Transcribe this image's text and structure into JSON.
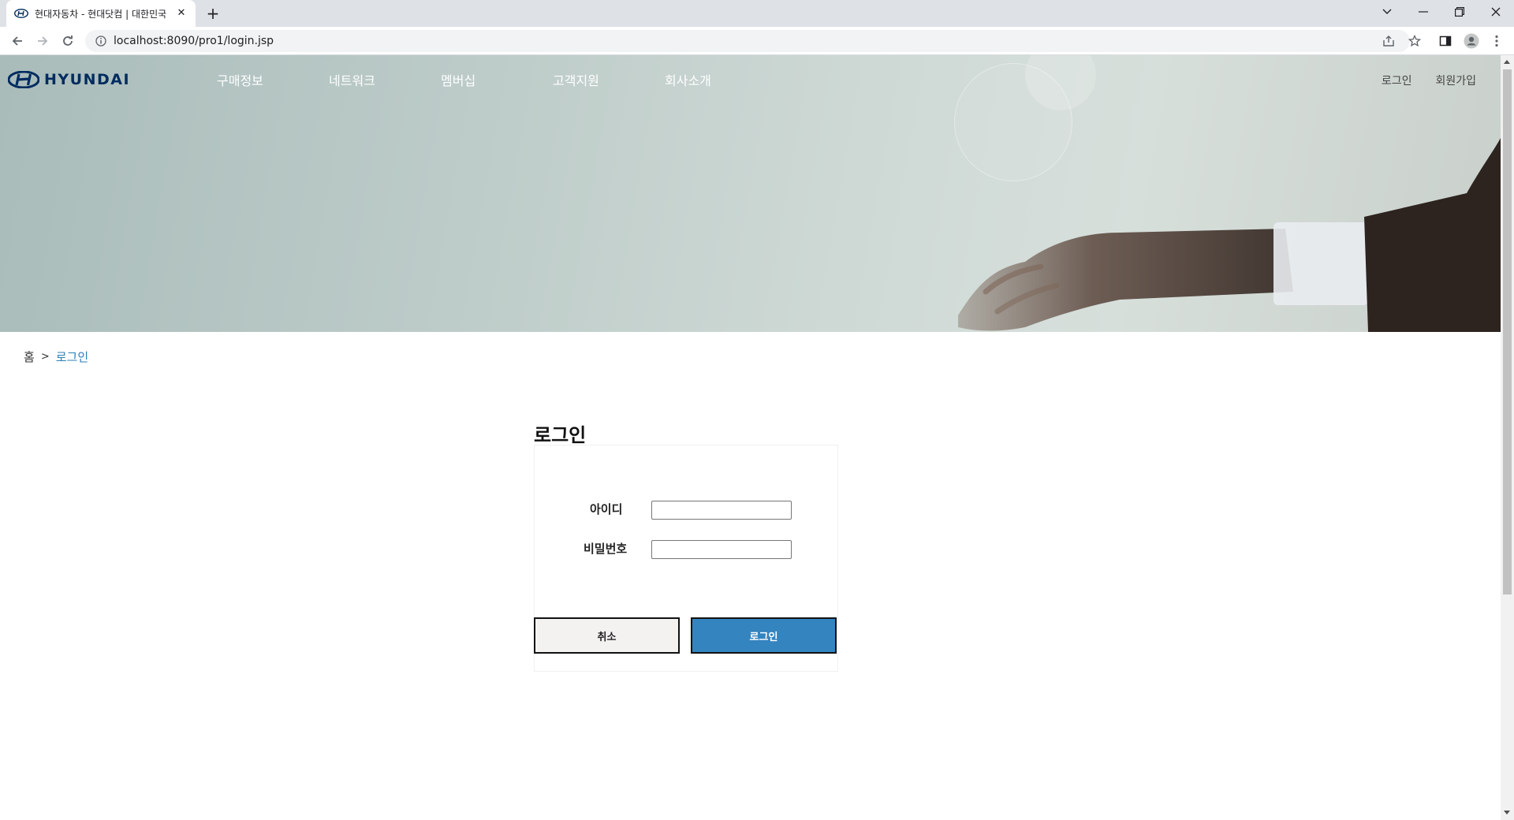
{
  "browser": {
    "tab_title": "현대자동차 - 현대닷컴 | 대한민국",
    "url": "localhost:8090/pro1/login.jsp",
    "new_tab_glyph": "+",
    "close_glyph": "✕"
  },
  "header": {
    "logo_text": "HYUNDAI",
    "gnb": [
      {
        "label": "구매정보"
      },
      {
        "label": "네트워크"
      },
      {
        "label": "멤버십"
      },
      {
        "label": "고객지원"
      },
      {
        "label": "회사소개"
      }
    ],
    "util": {
      "login": "로그인",
      "signup": "회원가입"
    }
  },
  "breadcrumb": {
    "home": "홈",
    "separator": ">",
    "current": "로그인"
  },
  "login_form": {
    "title": "로그인",
    "id_label": "아이디",
    "id_value": "",
    "password_label": "비밀번호",
    "password_value": "",
    "cancel_label": "취소",
    "submit_label": "로그인"
  },
  "colors": {
    "brand": "#002c5f",
    "accent": "#3484bf",
    "breadcrumb_current": "#2d7fb8"
  }
}
